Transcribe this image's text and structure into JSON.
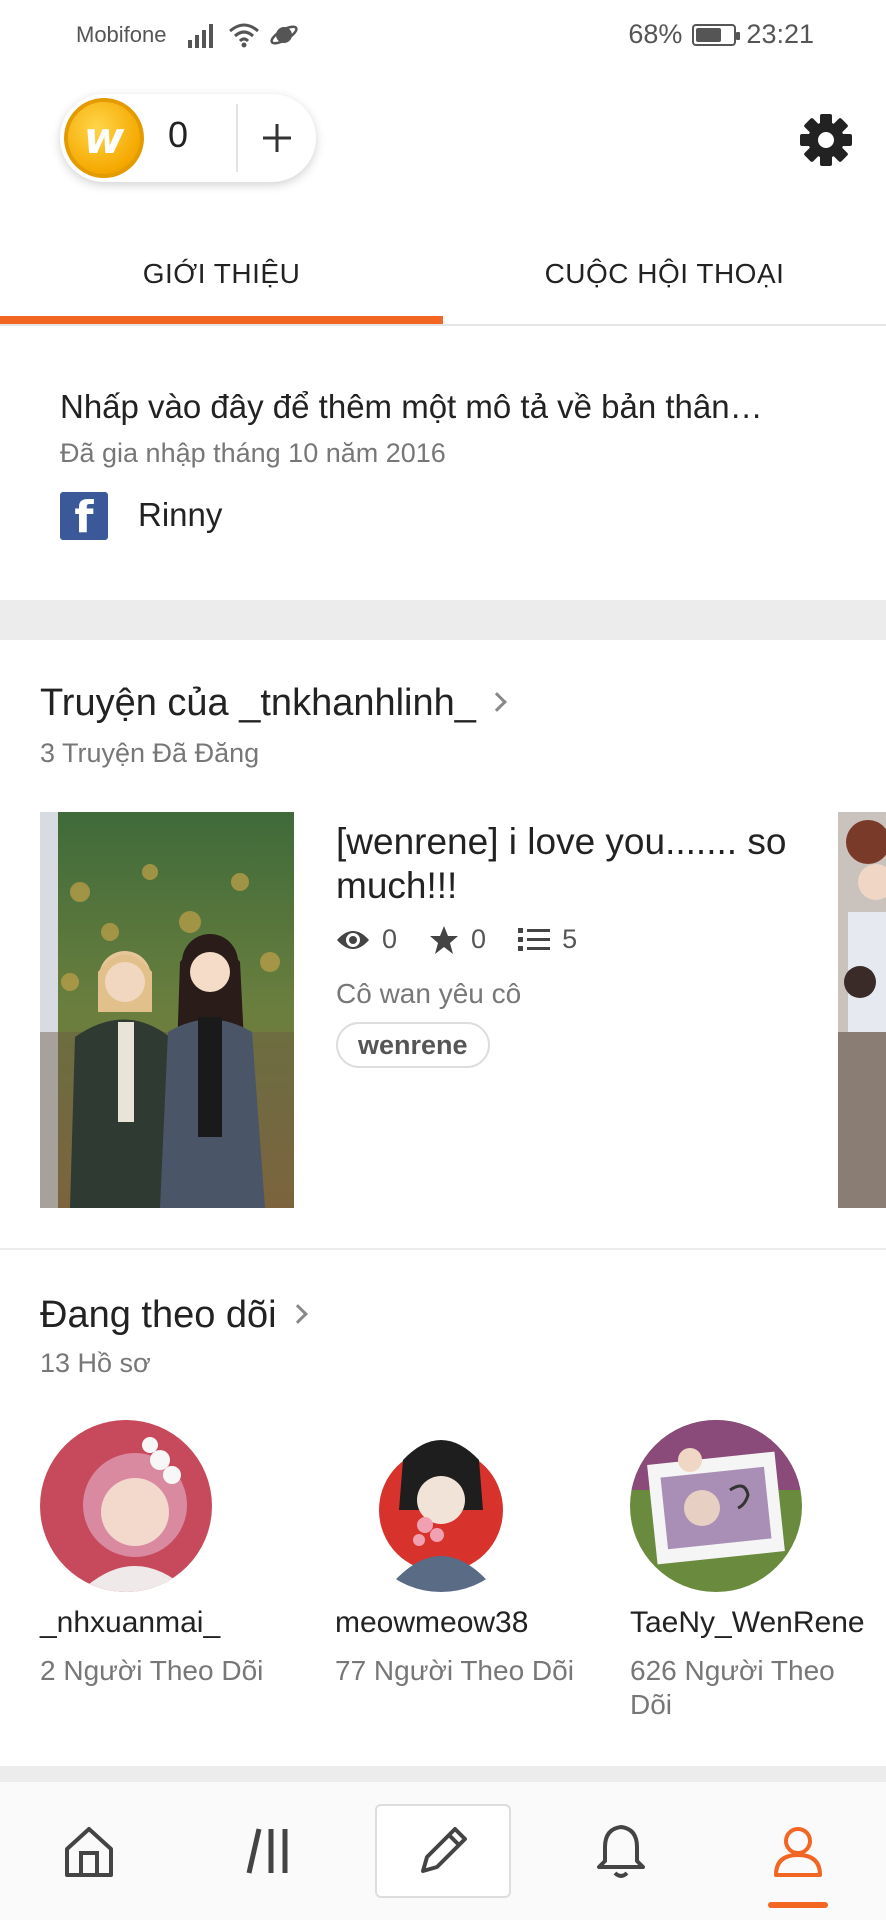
{
  "status_bar": {
    "carrier": "Mobifone",
    "battery": "68%",
    "battery_level": 0.68,
    "time": "23:21"
  },
  "coins": {
    "count": "0"
  },
  "tabs": [
    {
      "label": "GIỚI THIỆU",
      "active": true
    },
    {
      "label": "CUỘC HỘI THOẠI",
      "active": false
    }
  ],
  "about": {
    "description_prompt": "Nhấp vào đây để thêm một mô tả về bản thân…",
    "joined": "Đã gia nhập tháng 10 năm 2016",
    "facebook_name": "Rinny"
  },
  "stories": {
    "title": "Truyện của _tnkhanhlinh_",
    "subtitle": "3 Truyện Đã Đăng",
    "items": [
      {
        "title": "[wenrene] i love you....... so much!!!",
        "views": "0",
        "votes": "0",
        "parts": "5",
        "description": "Cô wan yêu cô",
        "tag": "wenrene"
      }
    ]
  },
  "following": {
    "title": "Đang theo dõi",
    "subtitle": "13 Hồ sơ",
    "profiles": [
      {
        "name": "_nhxuanmai_",
        "followers": "2 Người Theo Dõi"
      },
      {
        "name": "meowmeow38",
        "followers": "77 Người Theo Dõi"
      },
      {
        "name": "TaeNy_WenRene",
        "followers": "626 Người Theo Dõi"
      }
    ]
  },
  "colors": {
    "accent": "#f26522",
    "facebook": "#3b5998",
    "coin": "#f5a900"
  },
  "bottom_nav": [
    "home-icon",
    "library-icon",
    "write-icon",
    "notifications-icon",
    "profile-icon"
  ]
}
